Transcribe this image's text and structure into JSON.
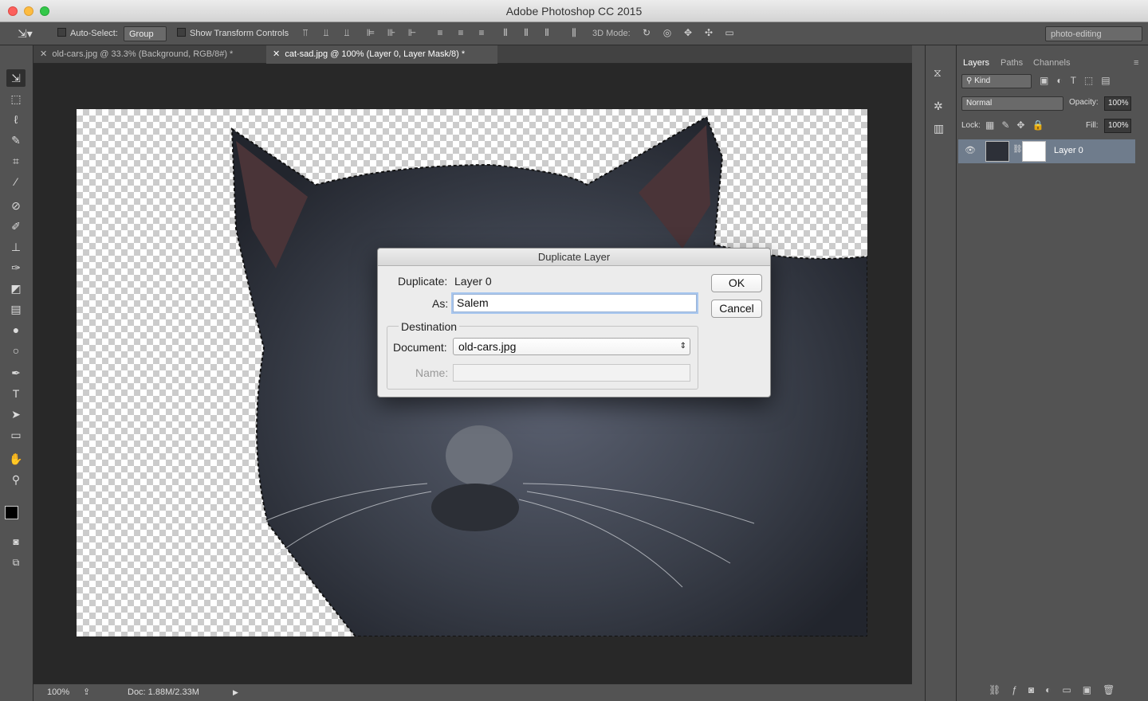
{
  "window": {
    "title": "Adobe Photoshop CC 2015"
  },
  "options_bar": {
    "auto_select_label": "Auto-Select:",
    "auto_select_value": "Group",
    "show_transform_label": "Show Transform Controls",
    "mode_3d_label": "3D Mode:",
    "workspace": "photo-editing"
  },
  "tabs": [
    {
      "label": "old-cars.jpg @ 33.3% (Background, RGB/8#) *"
    },
    {
      "label": "cat-sad.jpg @ 100% (Layer 0, Layer Mask/8) *"
    }
  ],
  "status": {
    "zoom": "100%",
    "doc": "Doc: 1.88M/2.33M"
  },
  "layers_panel": {
    "tabs": [
      "Layers",
      "Paths",
      "Channels"
    ],
    "filter": "Kind",
    "blend_mode": "Normal",
    "opacity_label": "Opacity:",
    "opacity_value": "100%",
    "lock_label": "Lock:",
    "fill_label": "Fill:",
    "fill_value": "100%",
    "layers": [
      {
        "name": "Layer 0"
      }
    ]
  },
  "dialog": {
    "title": "Duplicate Layer",
    "duplicate_label": "Duplicate:",
    "duplicate_value": "Layer 0",
    "as_label": "As:",
    "as_value": "Salem",
    "destination_label": "Destination",
    "document_label": "Document:",
    "document_value": "old-cars.jpg",
    "name_label": "Name:",
    "name_value": "",
    "ok_label": "OK",
    "cancel_label": "Cancel"
  }
}
